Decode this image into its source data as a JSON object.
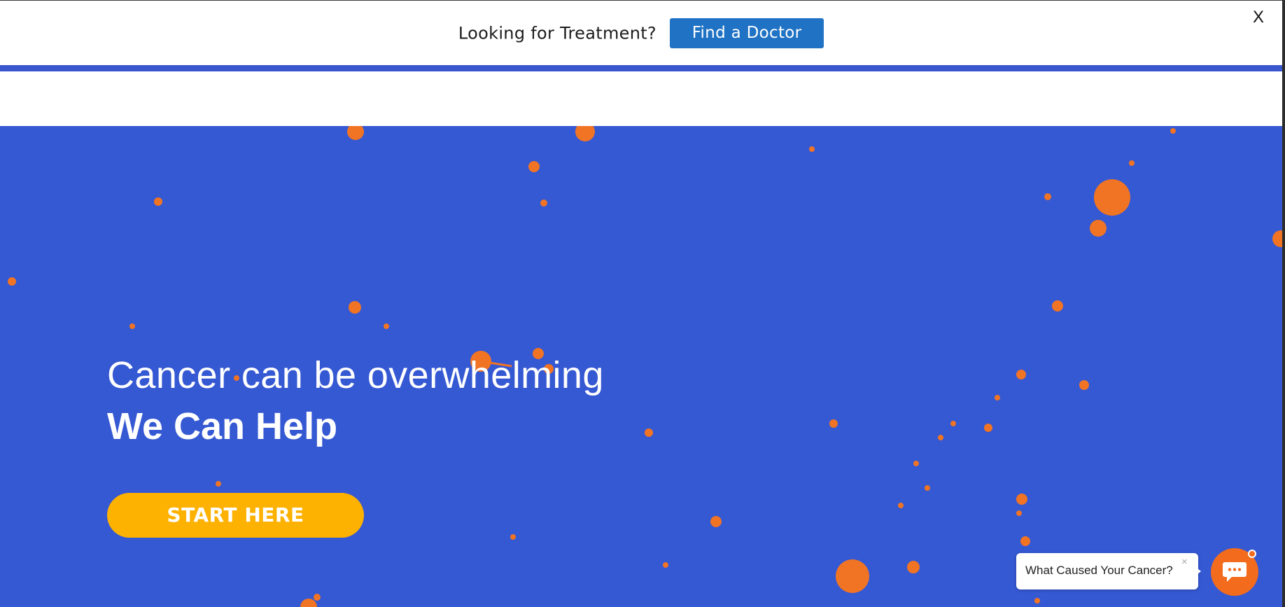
{
  "announcement": {
    "text": "Looking for Treatment?",
    "cta_label": "Find a Doctor",
    "close_label": "X"
  },
  "hero": {
    "headline": "Cancer can be overwhelming",
    "subheadline": "We Can Help",
    "cta_label": "START HERE",
    "decoration": "orange-particle-field"
  },
  "chat": {
    "prompt": "What Caused Your Cancer?",
    "close_label": "×",
    "icon": "chat-icon"
  },
  "colors": {
    "hero_background": "#3558d3",
    "accent_rule": "#3a57cf",
    "find_doctor_button": "#1f72c4",
    "start_button": "#fdb100",
    "particles": "#f07424",
    "chat_launcher": "#f36c1d"
  }
}
